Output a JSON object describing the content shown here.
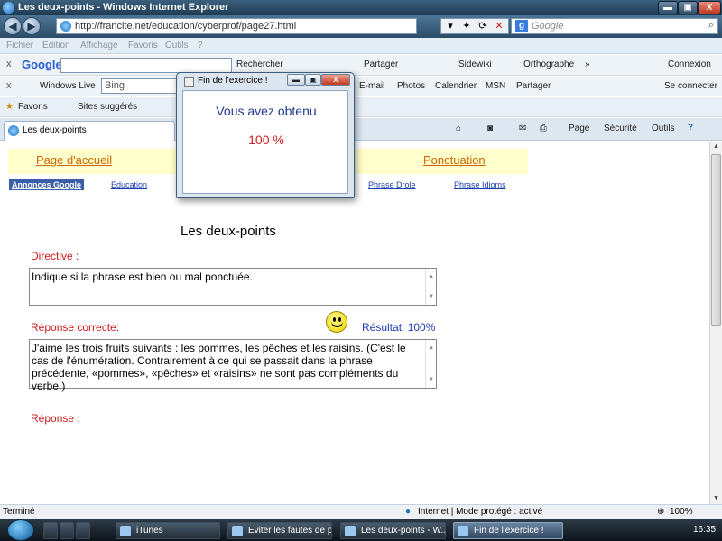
{
  "window": {
    "title": "Les deux-points - Windows Internet Explorer",
    "min_glyph": "▬",
    "max_glyph": "▣",
    "close_glyph": "X"
  },
  "address": {
    "back": "◀",
    "forward": "▶",
    "url": "http://francite.net/education/cyberprof/page27.html",
    "search_placeholder": "Google",
    "search_logo": "g",
    "search_glyph": "⌕",
    "refresh_glyph": "⟳",
    "compat_glyph": "✦",
    "stop_glyph": "✕",
    "dropdown_glyph": "▾"
  },
  "menu": [
    "Fichier",
    "Edition",
    "Affichage",
    "Favoris",
    "Outils",
    "?"
  ],
  "google_toolbar": {
    "close": "x",
    "logo": "Google",
    "rechercher": "Rechercher",
    "partager": "Partager",
    "sidewiki": "Sidewiki",
    "orthographe": "Orthographe",
    "more": "»",
    "connexion": "Connexion"
  },
  "live_toolbar": {
    "close": "x",
    "logo": "Windows Live",
    "search": "Bing",
    "items": [
      "E-mail",
      "Photos",
      "Calendrier",
      "MSN",
      "Partager"
    ],
    "se_connecter": "Se connecter"
  },
  "favorites_bar": {
    "favoris": "Favoris",
    "sites": "Sites suggérés"
  },
  "tabbar": {
    "tab_label": "Les deux-points",
    "tools": [
      "Page",
      "Sécurité",
      "Outils"
    ]
  },
  "page": {
    "nav_left": "Page d'accueil",
    "nav_right": "Ponctuation",
    "ads": "Annonces Google",
    "mini_links": [
      "Education",
      "Phrase Drole",
      "Phrase Idioms"
    ],
    "title": "Les deux-points",
    "directive_label": "Directive :",
    "directive_text": "Indique si la phrase est bien ou mal ponctuée.",
    "correct_label": "Réponse correcte:",
    "resultat": "Résultat: 100%",
    "correct_text": "J'aime les trois fruits suivants : les pommes, les pêches et les raisins. (C'est le cas de l'énumération. Contrairement à ce qui se passait dans la phrase précédente, «pommes», «pêches» et «raisins» ne sont pas compléments du verbe.)",
    "reponse_label": "Réponse :"
  },
  "popup": {
    "title": "Fin de l'exercice !",
    "message": "Vous avez obtenu",
    "score": "100 %"
  },
  "status": {
    "left": "Terminé",
    "zone": "Internet | Mode protégé : activé",
    "zoom": "100%"
  },
  "taskbar": {
    "buttons": [
      {
        "label": "iTunes",
        "active": false
      },
      {
        "label": "Eviter les fautes de p...",
        "active": false
      },
      {
        "label": "Les deux-points - W...",
        "active": false
      },
      {
        "label": "Fin de l'exercice !",
        "active": true
      }
    ],
    "clock": "16:35"
  }
}
